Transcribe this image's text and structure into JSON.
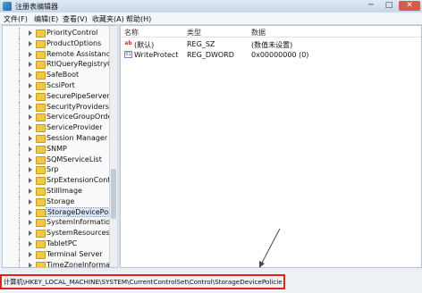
{
  "window": {
    "title": "注册表编辑器",
    "min_symbol": "─",
    "max_symbol": "□",
    "close_symbol": "✕"
  },
  "menu": [
    "文件(F)",
    "编辑(E)",
    "查看(V)",
    "收藏夹(A)",
    "帮助(H)"
  ],
  "tree": {
    "items": [
      "PriorityControl",
      "ProductOptions",
      "Remote Assistance",
      "RtlQueryRegistryConf",
      "SafeBoot",
      "ScsiPort",
      "SecurePipeServers",
      "SecurityProviders",
      "ServiceGroupOrder",
      "ServiceProvider",
      "Session Manager",
      "SNMP",
      "SQMServiceList",
      "Srp",
      "SrpExtensionConfig",
      "StillImage",
      "Storage",
      "StorageDevicePolicies",
      "SystemInformation",
      "SystemResources",
      "TabletPC",
      "Terminal Server",
      "TimeZoneInformation"
    ],
    "selected": "StorageDevicePolicies"
  },
  "values": {
    "columns": [
      "名称",
      "类型",
      "数据"
    ],
    "rows": [
      {
        "icon": "string-value-icon",
        "glyph": "ab",
        "name": "(默认)",
        "type": "REG_SZ",
        "data": "(数值未设置)"
      },
      {
        "icon": "binary-value-icon",
        "glyph": "01",
        "name": "WriteProtect",
        "type": "REG_DWORD",
        "data": "0x00000000 (0)"
      }
    ]
  },
  "status": {
    "path": "计算机\\HKEY_LOCAL_MACHINE\\SYSTEM\\CurrentControlSet\\Control\\StorageDevicePolicies"
  },
  "colors": {
    "highlight_box": "#e0231b",
    "folder": "#f0c84a",
    "close_button": "#d95a4a"
  }
}
